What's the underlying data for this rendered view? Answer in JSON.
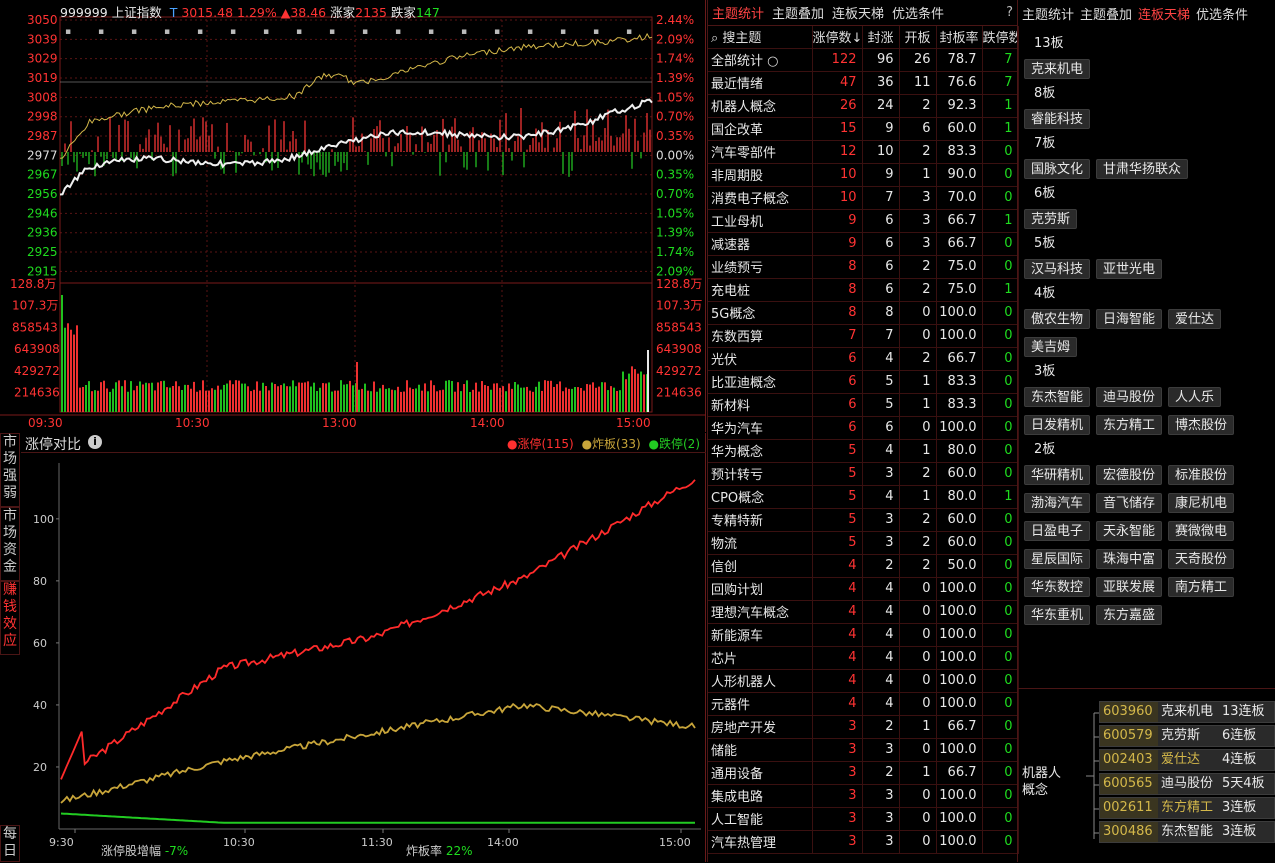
{
  "index_header": {
    "code": "999999",
    "name": "上证指数",
    "flag": "T",
    "price": "3015.48",
    "pct": "1.29%",
    "change": "▲38.46",
    "up_label": "涨家",
    "up_count": "2135",
    "down_label": "跌家",
    "down_count": "147"
  },
  "price_axis_left": [
    "3050",
    "3039",
    "3029",
    "3019",
    "3008",
    "2998",
    "2987",
    "2977",
    "2967",
    "2956",
    "2946",
    "2936",
    "2925",
    "2915"
  ],
  "price_axis_right": [
    "2.44%",
    "2.09%",
    "1.74%",
    "1.39%",
    "1.05%",
    "0.70%",
    "0.35%",
    "0.00%",
    "0.35%",
    "0.70%",
    "1.05%",
    "1.39%",
    "1.74%",
    "2.09%"
  ],
  "vol_axis": [
    "128.8万",
    "107.3万",
    "858543",
    "643908",
    "429272",
    "214636"
  ],
  "time_axis": [
    "09:30",
    "10:30",
    "13:00",
    "14:00",
    "15:00"
  ],
  "limit_chart": {
    "title": "涨停对比",
    "legend": [
      {
        "label": "涨停(115)",
        "color": "#ff3030"
      },
      {
        "label": "炸板(33)",
        "color": "#c8a53a"
      },
      {
        "label": "跌停(2)",
        "color": "#22cc22"
      }
    ],
    "yticks": [
      "100",
      "80",
      "60",
      "40",
      "20"
    ],
    "xticks": [
      "9:30",
      "10:30",
      "11:30",
      "14:00",
      "15:00"
    ],
    "footer_left_label": "涨停股增幅",
    "footer_left_val": "-7%",
    "footer_right_label": "炸板率",
    "footer_right_val": "22%"
  },
  "chart_data": {
    "type": "line",
    "x": [
      "9:30",
      "10:30",
      "11:30",
      "14:00",
      "15:00"
    ],
    "series": [
      {
        "name": "涨停",
        "values": [
          16,
          52,
          62,
          81,
          113
        ]
      },
      {
        "name": "炸板",
        "values": [
          9,
          22,
          31,
          40,
          33
        ]
      },
      {
        "name": "跌停",
        "values": [
          5,
          2,
          2,
          2,
          2
        ]
      }
    ],
    "ylim": [
      0,
      118
    ]
  },
  "side_buttons": [
    "市场强弱",
    "市场资金",
    "赚钱效应",
    "每日"
  ],
  "theme_tabs": [
    "主题统计",
    "主题叠加",
    "连板天梯",
    "优选条件"
  ],
  "theme_help": "?",
  "theme_headers": [
    "搜主题",
    "涨停数↓",
    "封涨",
    "开板",
    "封板率",
    "跌停数"
  ],
  "theme_rows": [
    [
      "全部统计",
      "122",
      "96",
      "26",
      "78.7",
      "7"
    ],
    [
      "最近情绪",
      "47",
      "36",
      "11",
      "76.6",
      "7"
    ],
    [
      "机器人概念",
      "26",
      "24",
      "2",
      "92.3",
      "1"
    ],
    [
      "国企改革",
      "15",
      "9",
      "6",
      "60.0",
      "1"
    ],
    [
      "汽车零部件",
      "12",
      "10",
      "2",
      "83.3",
      "0"
    ],
    [
      "非周期股",
      "10",
      "9",
      "1",
      "90.0",
      "0"
    ],
    [
      "消费电子概念",
      "10",
      "7",
      "3",
      "70.0",
      "0"
    ],
    [
      "工业母机",
      "9",
      "6",
      "3",
      "66.7",
      "1"
    ],
    [
      "减速器",
      "9",
      "6",
      "3",
      "66.7",
      "0"
    ],
    [
      "业绩预亏",
      "8",
      "6",
      "2",
      "75.0",
      "0"
    ],
    [
      "充电桩",
      "8",
      "6",
      "2",
      "75.0",
      "1"
    ],
    [
      "5G概念",
      "8",
      "8",
      "0",
      "100.0",
      "0"
    ],
    [
      "东数西算",
      "7",
      "7",
      "0",
      "100.0",
      "0"
    ],
    [
      "光伏",
      "6",
      "4",
      "2",
      "66.7",
      "0"
    ],
    [
      "比亚迪概念",
      "6",
      "5",
      "1",
      "83.3",
      "0"
    ],
    [
      "新材料",
      "6",
      "5",
      "1",
      "83.3",
      "0"
    ],
    [
      "华为汽车",
      "6",
      "6",
      "0",
      "100.0",
      "0"
    ],
    [
      "华为概念",
      "5",
      "4",
      "1",
      "80.0",
      "0"
    ],
    [
      "预计转亏",
      "5",
      "3",
      "2",
      "60.0",
      "0"
    ],
    [
      "CPO概念",
      "5",
      "4",
      "1",
      "80.0",
      "1"
    ],
    [
      "专精特新",
      "5",
      "3",
      "2",
      "60.0",
      "0"
    ],
    [
      "物流",
      "5",
      "3",
      "2",
      "60.0",
      "0"
    ],
    [
      "信创",
      "4",
      "2",
      "2",
      "50.0",
      "0"
    ],
    [
      "回购计划",
      "4",
      "4",
      "0",
      "100.0",
      "0"
    ],
    [
      "理想汽车概念",
      "4",
      "4",
      "0",
      "100.0",
      "0"
    ],
    [
      "新能源车",
      "4",
      "4",
      "0",
      "100.0",
      "0"
    ],
    [
      "芯片",
      "4",
      "4",
      "0",
      "100.0",
      "0"
    ],
    [
      "人形机器人",
      "4",
      "4",
      "0",
      "100.0",
      "0"
    ],
    [
      "元器件",
      "4",
      "4",
      "0",
      "100.0",
      "0"
    ],
    [
      "房地产开发",
      "3",
      "2",
      "1",
      "66.7",
      "0"
    ],
    [
      "储能",
      "3",
      "3",
      "0",
      "100.0",
      "0"
    ],
    [
      "通用设备",
      "3",
      "2",
      "1",
      "66.7",
      "0"
    ],
    [
      "集成电路",
      "3",
      "3",
      "0",
      "100.0",
      "0"
    ],
    [
      "人工智能",
      "3",
      "3",
      "0",
      "100.0",
      "0"
    ],
    [
      "汽车热管理",
      "3",
      "3",
      "0",
      "100.0",
      "0"
    ]
  ],
  "ladder_tabs": [
    "主题统计",
    "主题叠加",
    "连板天梯",
    "优选条件"
  ],
  "ladder": [
    {
      "level": "13板",
      "stocks": [
        "克来机电"
      ]
    },
    {
      "level": "8板",
      "stocks": [
        "睿能科技"
      ]
    },
    {
      "level": "7板",
      "stocks": [
        "国脉文化",
        "甘肃华扬联众"
      ]
    },
    {
      "level": "6板",
      "stocks": [
        "克劳斯"
      ]
    },
    {
      "level": "5板",
      "stocks": [
        "汉马科技",
        "亚世光电"
      ]
    },
    {
      "level": "4板",
      "stocks": [
        "傲农生物",
        "日海智能",
        "爱仕达",
        "美吉姆"
      ]
    },
    {
      "level": "3板",
      "stocks": [
        "东杰智能",
        "迪马股份",
        "人人乐",
        "日发精机",
        "东方精工",
        "博杰股份"
      ]
    },
    {
      "level": "2板",
      "stocks": [
        "华研精机",
        "宏德股份",
        "标准股份",
        "渤海汽车",
        "音飞储存",
        "康尼机电",
        "日盈电子",
        "天永智能",
        "赛微微电",
        "星辰国际",
        "珠海中富",
        "天奇股份",
        "华东数控",
        "亚联发展",
        "南方精工",
        "华东重机",
        "东方嘉盛"
      ]
    }
  ],
  "robot": {
    "label": "机器人概念",
    "rows": [
      {
        "code": "603960",
        "name": "克来机电",
        "boards": "13连板"
      },
      {
        "code": "600579",
        "name": "克劳斯",
        "boards": "6连板"
      },
      {
        "code": "002403",
        "name": "爱仕达",
        "boards": "4连板"
      },
      {
        "code": "600565",
        "name": "迪马股份",
        "boards": "5天4板"
      },
      {
        "code": "002611",
        "name": "东方精工",
        "boards": "3连板"
      },
      {
        "code": "300486",
        "name": "东杰智能",
        "boards": "3连板"
      }
    ]
  }
}
